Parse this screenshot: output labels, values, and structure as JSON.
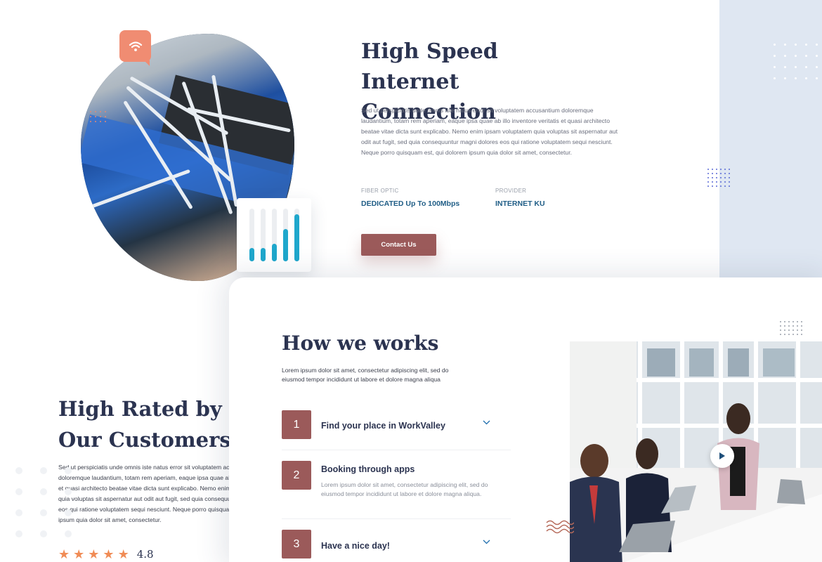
{
  "internet": {
    "title": "High Speed Internet Connection",
    "description": "Sed ut perspiciatis unde omnis iste natus error sit voluptatem accusantium doloremque laudantium, totam rem aperiam, eaque ipsa quae ab illo inventore veritatis et quasi architecto beatae vitae dicta sunt explicabo. Nemo enim ipsam voluptatem quia voluptas sit aspernatur aut odit aut fugit, sed quia consequuntur magni dolores eos qui ratione voluptatem sequi nesciunt. Neque porro quisquam est, qui dolorem ipsum quia dolor sit amet, consectetur.",
    "fiber_label": "FIBER OPTIC",
    "fiber_value": "DEDICATED Up To 100Mbps",
    "provider_label": "PROVIDER",
    "provider_value": "INTERNET KU",
    "contact_button": "Contact Us",
    "signal_levels": [
      0.25,
      0.25,
      0.33,
      0.62,
      0.9
    ]
  },
  "rated": {
    "title": "High Rated by Our Customers",
    "description": "Sed ut perspiciatis unde omnis iste natus error sit voluptatem accusantium doloremque laudantium, totam rem aperiam, eaque ipsa quae ab illo inventore veritatis et quasi architecto beatae vitae dicta sunt explicabo. Nemo enim ipsam voluptatem quia voluptas sit aspernatur aut odit aut fugit, sed quia consequuntur magni dolores eos qui ratione voluptatem sequi nesciunt. Neque porro quisquam est, qui dolorem ipsum quia dolor sit amet, consectetur.",
    "rating": "4.8",
    "stars": 5
  },
  "works": {
    "title": "How we works",
    "subtitle": "Lorem ipsum dolor sit amet, consectetur adipiscing elit, sed do eiusmod tempor incididunt ut labore et dolore magna aliqua",
    "steps": [
      {
        "num": "1",
        "title": "Find your place in WorkValley",
        "desc": ""
      },
      {
        "num": "2",
        "title": "Booking through apps",
        "desc": "Lorem ipsum dolor sit amet, consectetur adipiscing elit, sed do eiusmod tempor incididunt ut labore et dolore magna aliqua."
      },
      {
        "num": "3",
        "title": "Have a nice day!",
        "desc": ""
      }
    ]
  },
  "colors": {
    "accent": "#9b5a5a",
    "orange": "#f08c72",
    "heading": "#2b3350",
    "link_blue": "#1f5d86",
    "signal_blue": "#1fa7cc"
  },
  "icons": {
    "wifi": "wifi-icon",
    "play": "play-icon",
    "chevron": "chevron-down-icon",
    "star": "star-icon"
  }
}
